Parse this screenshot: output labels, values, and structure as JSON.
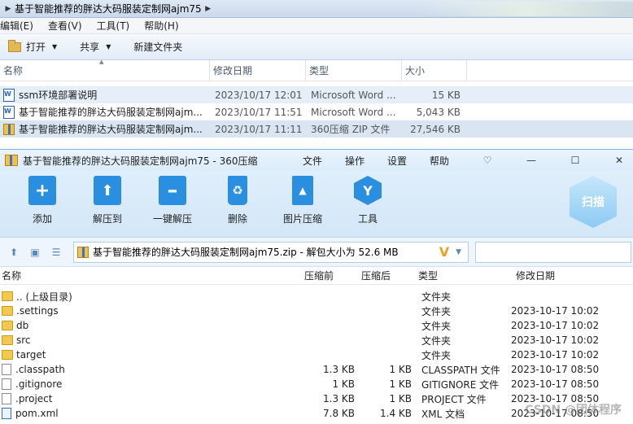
{
  "explorer": {
    "breadcrumb": "基于智能推荐的胖达大码服装定制网ajm75",
    "menu": [
      "编辑(E)",
      "查看(V)",
      "工具(T)",
      "帮助(H)"
    ],
    "commands": {
      "open": "打开",
      "share": "共享",
      "new_folder": "新建文件夹"
    },
    "columns": {
      "name": "名称",
      "date": "修改日期",
      "type": "类型",
      "size": "大小"
    },
    "files": [
      {
        "name": "ssm环境部署说明",
        "date": "2023/10/17 12:01",
        "type": "Microsoft Word ...",
        "size": "15 KB",
        "icon": "word-icon"
      },
      {
        "name": "基于智能推荐的胖达大码服装定制网ajm...",
        "date": "2023/10/17 11:51",
        "type": "Microsoft Word ...",
        "size": "5,043 KB",
        "icon": "word-icon"
      },
      {
        "name": "基于智能推荐的胖达大码服装定制网ajm...",
        "date": "2023/10/17 11:11",
        "type": "360压缩 ZIP 文件",
        "size": "27,546 KB",
        "icon": "zip-icon"
      }
    ]
  },
  "zip": {
    "title": "基于智能推荐的胖达大码服装定制网ajm75 - 360压缩",
    "menu": [
      "文件",
      "操作",
      "设置",
      "帮助"
    ],
    "toolbar": [
      "添加",
      "解压到",
      "一键解压",
      "删除",
      "图片压缩",
      "工具"
    ],
    "scan": "扫描",
    "path": "基于智能推荐的胖达大码服装定制网ajm75.zip - 解包大小为 52.6 MB",
    "columns": {
      "name": "名称",
      "packed": "压缩前",
      "compressed": "压缩后",
      "type": "类型",
      "modified": "修改日期"
    },
    "rows": [
      {
        "name": ".. (上级目录)",
        "packed": "",
        "compressed": "",
        "type": "文件夹",
        "modified": "",
        "kind": "folder"
      },
      {
        "name": ".settings",
        "packed": "",
        "compressed": "",
        "type": "文件夹",
        "modified": "2023-10-17 10:02",
        "kind": "folder"
      },
      {
        "name": "db",
        "packed": "",
        "compressed": "",
        "type": "文件夹",
        "modified": "2023-10-17 10:02",
        "kind": "folder"
      },
      {
        "name": "src",
        "packed": "",
        "compressed": "",
        "type": "文件夹",
        "modified": "2023-10-17 10:02",
        "kind": "folder"
      },
      {
        "name": "target",
        "packed": "",
        "compressed": "",
        "type": "文件夹",
        "modified": "2023-10-17 10:02",
        "kind": "folder"
      },
      {
        "name": ".classpath",
        "packed": "1.3 KB",
        "compressed": "1 KB",
        "type": "CLASSPATH 文件",
        "modified": "2023-10-17 08:50",
        "kind": "file"
      },
      {
        "name": ".gitignore",
        "packed": "1 KB",
        "compressed": "1 KB",
        "type": "GITIGNORE 文件",
        "modified": "2023-10-17 08:50",
        "kind": "file"
      },
      {
        "name": ".project",
        "packed": "1.3 KB",
        "compressed": "1 KB",
        "type": "PROJECT 文件",
        "modified": "2023-10-17 08:50",
        "kind": "file"
      },
      {
        "name": "pom.xml",
        "packed": "7.8 KB",
        "compressed": "1.4 KB",
        "type": "XML 文档",
        "modified": "2023-10-17 08:50",
        "kind": "xml"
      }
    ],
    "watermark": "CSDN @团体程序"
  }
}
